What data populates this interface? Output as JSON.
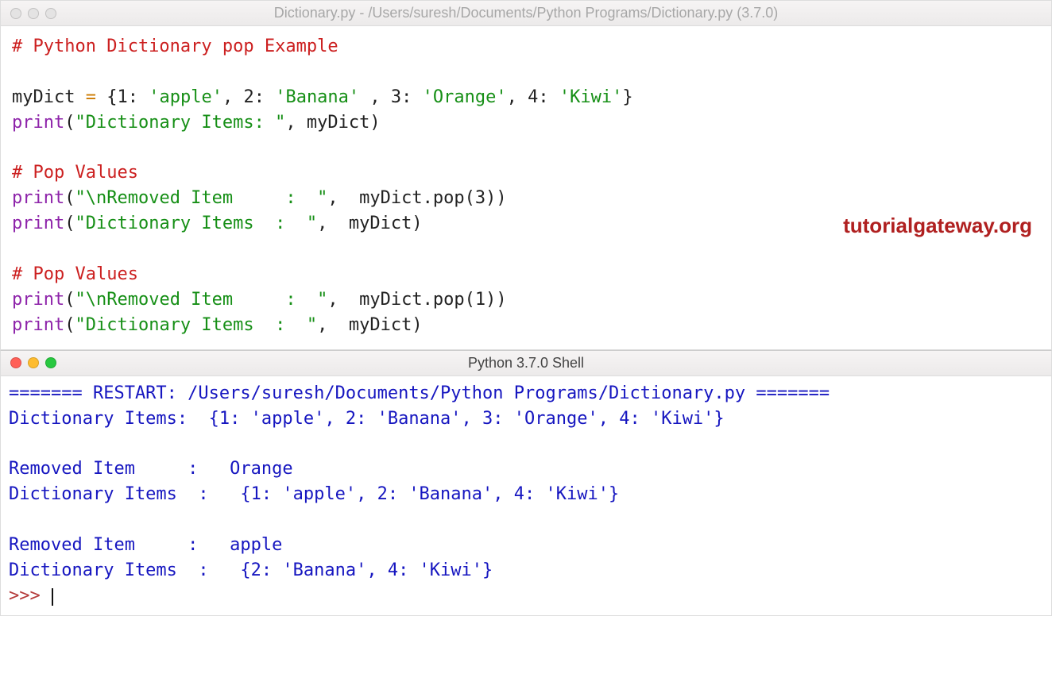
{
  "editorWindow": {
    "title": "Dictionary.py - /Users/suresh/Documents/Python Programs/Dictionary.py (3.7.0)"
  },
  "shellWindow": {
    "title": "Python 3.7.0 Shell"
  },
  "watermark": "tutorialgateway.org",
  "code": {
    "l1_comment": "# Python Dictionary pop Example",
    "l3_name": "myDict",
    "l3_k1": "1",
    "l3_v1": "'apple'",
    "l3_k2": "2",
    "l3_v2": "'Banana'",
    "l3_k3": "3",
    "l3_v3": "'Orange'",
    "l3_k4": "4",
    "l3_v4": "'Kiwi'",
    "l4_print": "print",
    "l4_str": "\"Dictionary Items: \"",
    "l4_arg": "myDict",
    "l6_comment": "# Pop Values",
    "l7_print": "print",
    "l7_str": "\"\\nRemoved Item     :  \"",
    "l7_call": "myDict.pop",
    "l7_arg": "3",
    "l8_print": "print",
    "l8_str": "\"Dictionary Items  :  \"",
    "l8_arg": "myDict",
    "l10_comment": "# Pop Values",
    "l11_print": "print",
    "l11_str": "\"\\nRemoved Item     :  \"",
    "l11_call": "myDict.pop",
    "l11_arg": "1",
    "l12_print": "print",
    "l12_str": "\"Dictionary Items  :  \"",
    "l12_arg": "myDict"
  },
  "shell": {
    "restart": "======= RESTART: /Users/suresh/Documents/Python Programs/Dictionary.py =======",
    "line1": "Dictionary Items:  {1: 'apple', 2: 'Banana', 3: 'Orange', 4: 'Kiwi'}",
    "line3": "Removed Item     :   Orange",
    "line4": "Dictionary Items  :   {1: 'apple', 2: 'Banana', 4: 'Kiwi'}",
    "line6": "Removed Item     :   apple",
    "line7": "Dictionary Items  :   {2: 'Banana', 4: 'Kiwi'}",
    "prompt": ">>> "
  }
}
